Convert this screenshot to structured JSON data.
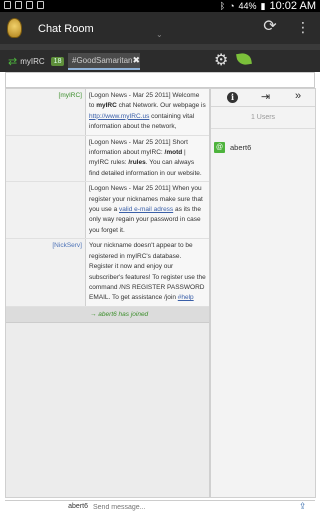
{
  "status_bar": {
    "battery": "44%",
    "time": "10:02 AM"
  },
  "app": {
    "title": "Chat Room"
  },
  "tabs": {
    "server": {
      "label": "myIRC",
      "count": "18"
    },
    "channel": {
      "label": "#GoodSamaritan"
    }
  },
  "messages": [
    {
      "nick": "[myIRC]",
      "html": "[Logon News - Mar 25 2011] Welcome to <b>myIRC</b> chat Network. Our webpage is <u>http://www.myIRC.us</u> containing vital information about the network,"
    },
    {
      "nick": "",
      "html": "[Logon News - Mar 25 2011] Short information about myIRC: <b>/motd</b> | myIRC rules: <b>/rules</b>. You can always find detailed information in our website."
    },
    {
      "nick": "",
      "html": "[Logon News - Mar 25 2011] When you register your nicknames make sure that you use a <u>valid e-mail adress</u> as its the only way regain your password in case you forget it."
    },
    {
      "nick": "[NickServ]",
      "html": "Your nickname doesn't appear to be registered in myIRC's database. Register it now and enjoy our subscriber's features! To register use the command /NS REGISTER PASSWORD EMAIL. To get assistance /join <u>#help</u>"
    }
  ],
  "join_notice": "→ abert6 has joined",
  "users": {
    "count_label": "1 Users",
    "list": [
      {
        "prefix": "@",
        "name": "abert6"
      }
    ]
  },
  "input": {
    "nick": "abert6",
    "placeholder": "Send message..."
  },
  "icons": [
    "refresh-icon",
    "more-icon",
    "gear-icon",
    "leaf-icon",
    "info-icon",
    "exit-icon",
    "forward-icon",
    "send-icon"
  ]
}
